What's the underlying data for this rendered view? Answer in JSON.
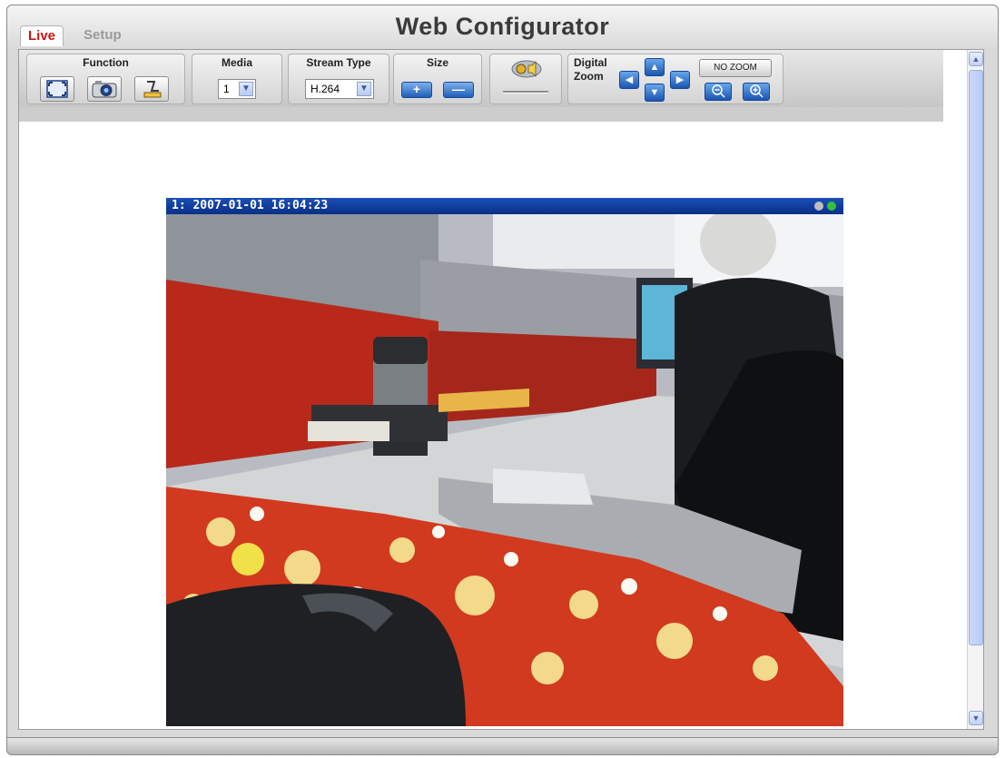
{
  "tabs": {
    "live": "Live",
    "setup": "Setup"
  },
  "app_title": "Web Configurator",
  "toolbar": {
    "function": {
      "label": "Function"
    },
    "media": {
      "label": "Media",
      "value": "1"
    },
    "stream_type": {
      "label": "Stream Type",
      "value": "H.264"
    },
    "size": {
      "label": "Size",
      "increase": "+",
      "decrease": "—"
    },
    "digital_zoom": {
      "label_line1": "Digital",
      "label_line2": "Zoom",
      "no_zoom": "NO ZOOM"
    }
  },
  "video": {
    "overlay": "1:  2007-01-01 16:04:23"
  },
  "colors": {
    "live_tab": "#d01010",
    "title_bar": "#0a2f86",
    "button_blue": "#1e5fb8"
  }
}
